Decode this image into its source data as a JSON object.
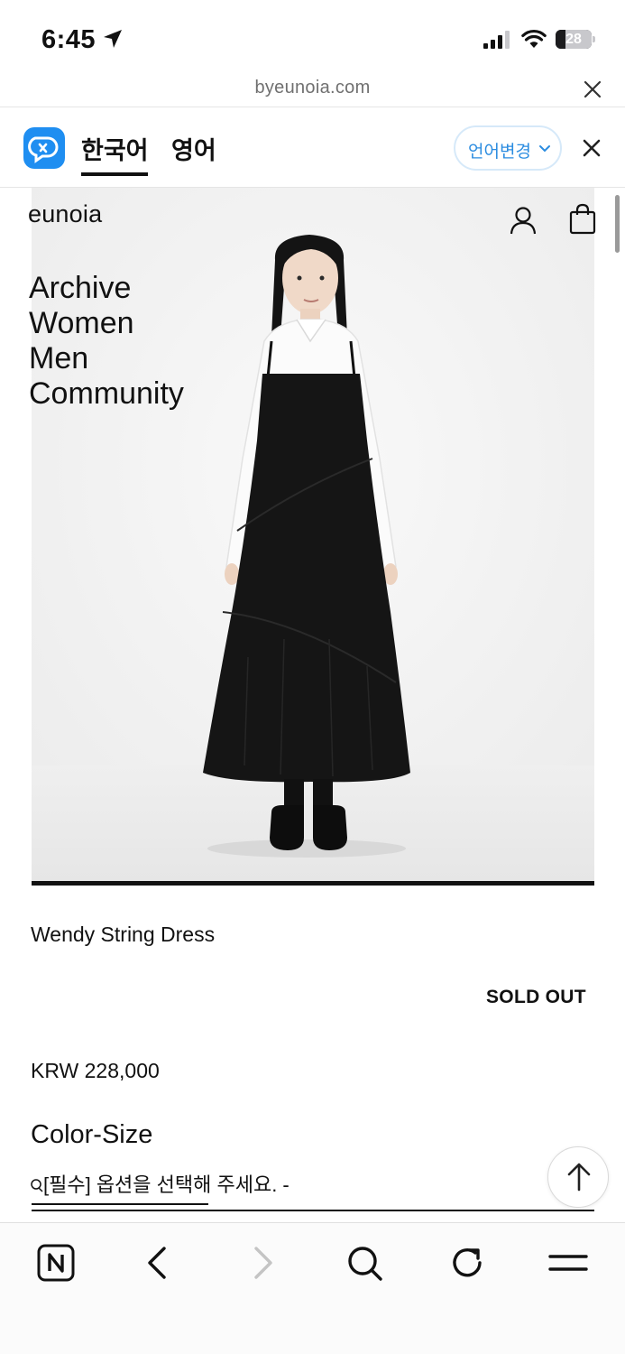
{
  "status_bar": {
    "time": "6:45",
    "battery": "28",
    "battery_level": 0.28
  },
  "browser": {
    "url": "byeunoia.com"
  },
  "translator": {
    "tabs": [
      {
        "label": "한국어",
        "selected": true
      },
      {
        "label": "영어",
        "selected": false
      }
    ],
    "change_language_label": "언어변경"
  },
  "header": {
    "brand": "eunoia"
  },
  "nav": {
    "items": [
      "Archive",
      "Women",
      "Men",
      "Community"
    ]
  },
  "product": {
    "name": "Wendy String Dress",
    "status": "SOLD OUT",
    "price": "KRW 228,000",
    "option_title": "Color-Size",
    "option_select_value": "[필수] 옵션을 선택해 주세요. -"
  },
  "colors": {
    "accent": "#2b8ce0",
    "papago": "#1f8ef1",
    "text": "#111111"
  },
  "icons": [
    "location-arrow-icon",
    "signal-icon",
    "wifi-icon",
    "battery-icon",
    "close-icon",
    "papago-logo-icon",
    "chevron-down-icon",
    "user-icon",
    "shopping-bag-icon",
    "arrow-up-icon",
    "naver-home-icon",
    "back-icon",
    "forward-icon",
    "search-icon",
    "reload-icon",
    "menu-icon"
  ]
}
